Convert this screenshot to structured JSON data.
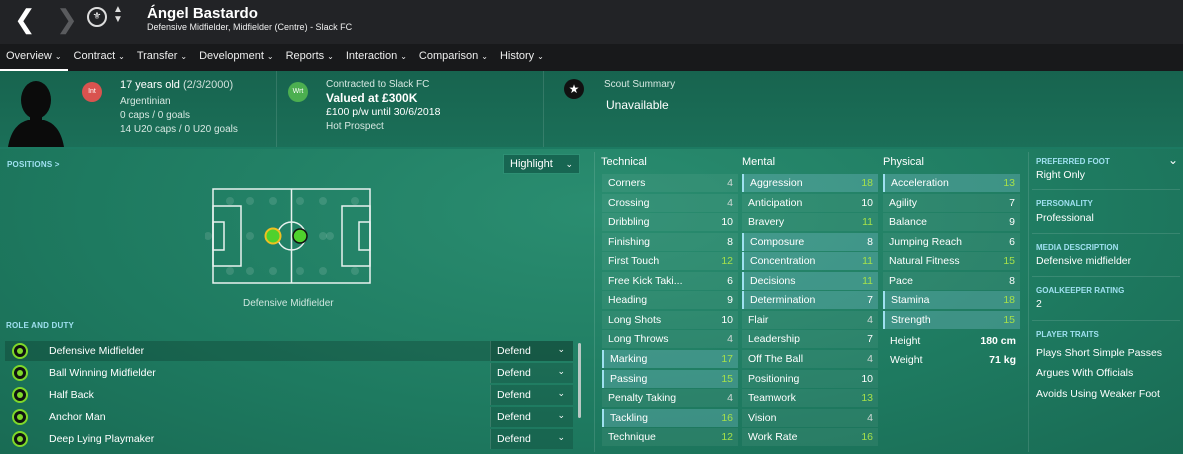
{
  "header": {
    "player_name": "Ángel Bastardo",
    "subtitle": "Defensive Midfielder, Midfielder (Centre) - Slack FC",
    "back_glyph": "❮",
    "forward_glyph": "❯",
    "updown_glyph": "⌃⌄"
  },
  "menu": [
    {
      "label": "Overview",
      "active": true
    },
    {
      "label": "Contract"
    },
    {
      "label": "Transfer"
    },
    {
      "label": "Development"
    },
    {
      "label": "Reports"
    },
    {
      "label": "Interaction"
    },
    {
      "label": "Comparison"
    },
    {
      "label": "History"
    }
  ],
  "info": {
    "int_badge": "Int",
    "age": "17 years old",
    "dob": "(2/3/2000)",
    "nationality": "Argentinian",
    "caps": "0 caps / 0 goals",
    "u20_caps": "14 U20 caps / 0 U20 goals",
    "wrt_badge": "Wrt",
    "contract_label": "Contracted to Slack FC",
    "value": "Valued at £300K",
    "wage": "£100 p/w until 30/6/2018",
    "status": "Hot Prospect",
    "scout_label": "Scout Summary",
    "scout_value": "Unavailable"
  },
  "positions": {
    "label": "POSITIONS >",
    "highlight": "Highlight",
    "caption": "Defensive Midfielder"
  },
  "role_duty": {
    "label": "ROLE AND DUTY",
    "roles": [
      {
        "name": "Defensive Midfielder",
        "duty": "Defend"
      },
      {
        "name": "Ball Winning Midfielder",
        "duty": "Defend"
      },
      {
        "name": "Half Back",
        "duty": "Defend"
      },
      {
        "name": "Anchor Man",
        "duty": "Defend"
      },
      {
        "name": "Deep Lying Playmaker",
        "duty": "Defend"
      }
    ]
  },
  "attributes": {
    "technical_title": "Technical",
    "mental_title": "Mental",
    "physical_title": "Physical",
    "technical": [
      {
        "name": "Corners",
        "value": "4"
      },
      {
        "name": "Crossing",
        "value": "4"
      },
      {
        "name": "Dribbling",
        "value": "10"
      },
      {
        "name": "Finishing",
        "value": "8"
      },
      {
        "name": "First Touch",
        "value": "12"
      },
      {
        "name": "Free Kick Taki...",
        "value": "6"
      },
      {
        "name": "Heading",
        "value": "9"
      },
      {
        "name": "Long Shots",
        "value": "10"
      },
      {
        "name": "Long Throws",
        "value": "4"
      },
      {
        "name": "Marking",
        "value": "17"
      },
      {
        "name": "Passing",
        "value": "15"
      },
      {
        "name": "Penalty Taking",
        "value": "4"
      },
      {
        "name": "Tackling",
        "value": "16"
      },
      {
        "name": "Technique",
        "value": "12"
      }
    ],
    "mental": [
      {
        "name": "Aggression",
        "value": "18"
      },
      {
        "name": "Anticipation",
        "value": "10"
      },
      {
        "name": "Bravery",
        "value": "11"
      },
      {
        "name": "Composure",
        "value": "8"
      },
      {
        "name": "Concentration",
        "value": "11"
      },
      {
        "name": "Decisions",
        "value": "11"
      },
      {
        "name": "Determination",
        "value": "7"
      },
      {
        "name": "Flair",
        "value": "4"
      },
      {
        "name": "Leadership",
        "value": "7"
      },
      {
        "name": "Off The Ball",
        "value": "4"
      },
      {
        "name": "Positioning",
        "value": "10"
      },
      {
        "name": "Teamwork",
        "value": "13"
      },
      {
        "name": "Vision",
        "value": "4"
      },
      {
        "name": "Work Rate",
        "value": "16"
      }
    ],
    "physical": [
      {
        "name": "Acceleration",
        "value": "13"
      },
      {
        "name": "Agility",
        "value": "7"
      },
      {
        "name": "Balance",
        "value": "9"
      },
      {
        "name": "Jumping Reach",
        "value": "6"
      },
      {
        "name": "Natural Fitness",
        "value": "15"
      },
      {
        "name": "Pace",
        "value": "8"
      },
      {
        "name": "Stamina",
        "value": "18"
      },
      {
        "name": "Strength",
        "value": "15"
      }
    ],
    "height_label": "Height",
    "height_value": "180 cm",
    "weight_label": "Weight",
    "weight_value": "71 kg"
  },
  "side": {
    "foot_label": "PREFERRED FOOT",
    "foot_value": "Right Only",
    "personality_label": "PERSONALITY",
    "personality_value": "Professional",
    "media_label": "MEDIA DESCRIPTION",
    "media_value": "Defensive midfielder",
    "gk_label": "GOALKEEPER RATING",
    "gk_value": "2",
    "traits_label": "PLAYER TRAITS",
    "traits": [
      "Plays Short Simple Passes",
      "Argues With Officials",
      "Avoids Using Weaker Foot"
    ]
  },
  "colors": {
    "accent_green": "#a5e04a",
    "label_cyan": "#9fe0f0",
    "int_badge": "#d9534f",
    "wrt_badge": "#4caf50"
  }
}
